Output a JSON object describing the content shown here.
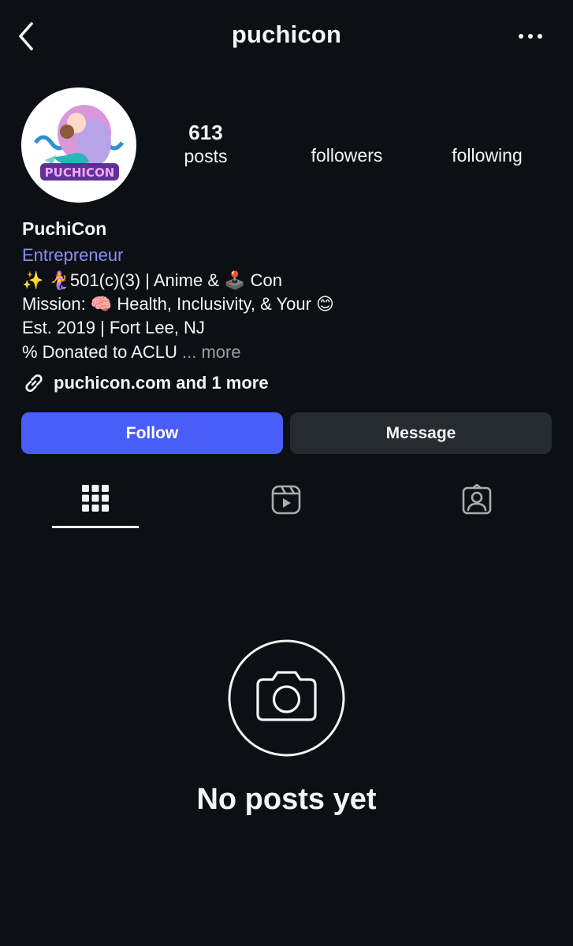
{
  "header": {
    "title": "puchicon",
    "back_icon": "chevron-left-icon",
    "more_icon": "more-horizontal-icon"
  },
  "profile": {
    "avatar_text": "PUCHICON",
    "stats": {
      "posts_count": "613",
      "posts_label": "posts",
      "followers_label": "followers",
      "following_label": "following"
    },
    "name": "PuchiCon",
    "category": "Entrepreneur",
    "bio": {
      "line1_prefix": "✨ 🧜‍♀️",
      "line1_text": "501(c)(3) | Anime & ",
      "line1_emoji": "🕹️",
      "line1_suffix": " Con",
      "line2_text": "Mission: ",
      "line2_emoji": "🧠",
      "line2_rest": " Health, Inclusivity, & Your ",
      "line2_emoji2": "😊",
      "line3": "Est. 2019 | Fort Lee, NJ",
      "line4_text": "% Donated to ACLU",
      "line4_ellipsis": " ...",
      "line4_more": " more"
    },
    "link": {
      "icon": "link-icon",
      "text": "puchicon.com and 1 more"
    }
  },
  "actions": {
    "follow_label": "Follow",
    "message_label": "Message"
  },
  "tabs": [
    {
      "name": "posts",
      "icon": "grid-icon",
      "active": true
    },
    {
      "name": "reels",
      "icon": "reels-icon",
      "active": false
    },
    {
      "name": "tagged",
      "icon": "tagged-person-icon",
      "active": false
    }
  ],
  "empty_state": {
    "icon": "camera-icon",
    "text": "No posts yet"
  },
  "colors": {
    "background": "#0c1014",
    "follow_button": "#4a5df9",
    "message_button": "#262a31",
    "category_text": "#8a8ef7"
  }
}
